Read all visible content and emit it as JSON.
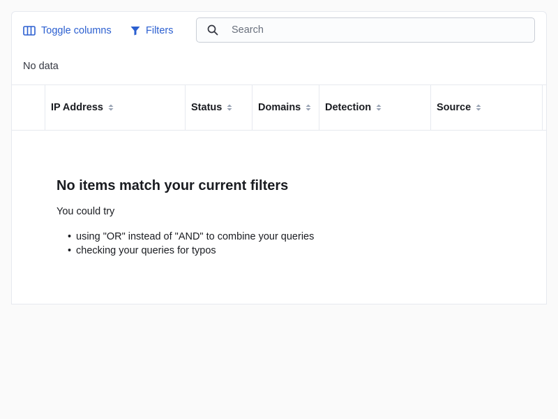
{
  "toolbar": {
    "toggle_columns_label": "Toggle columns",
    "filters_label": "Filters",
    "search_placeholder": "Search"
  },
  "results": {
    "count_text": "No data"
  },
  "table": {
    "columns": [
      {
        "label": "IP Address"
      },
      {
        "label": "Status"
      },
      {
        "label": "Domains"
      },
      {
        "label": "Detection"
      },
      {
        "label": "Source"
      }
    ]
  },
  "empty_state": {
    "title": "No items match your current filters",
    "body": "You could try",
    "suggestions": [
      "using \"OR\" instead of \"AND\" to combine your queries",
      "checking your queries for typos"
    ]
  },
  "icons": {
    "toggle_columns": "columns-icon",
    "filters": "filter-icon",
    "search": "search-icon",
    "sort": "sort-icon"
  },
  "colors": {
    "accent": "#2b5fd0",
    "border": "#e6e9ef",
    "page_background": "#fafafa"
  }
}
